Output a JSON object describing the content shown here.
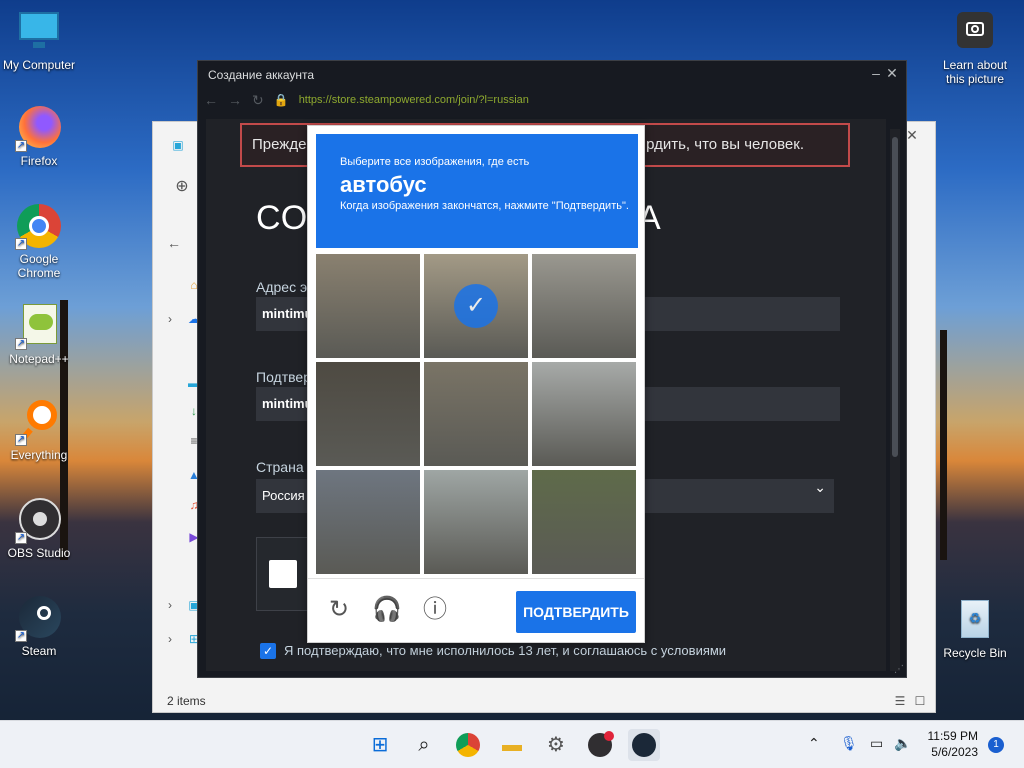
{
  "desktop": {
    "icons": [
      {
        "label": "My Computer",
        "icon": "monitor-icon"
      },
      {
        "label": "Firefox",
        "icon": "firefox-icon"
      },
      {
        "label": "Google Chrome",
        "icon": "chrome-icon"
      },
      {
        "label": "Notepad++",
        "icon": "notepadpp-icon"
      },
      {
        "label": "Everything",
        "icon": "search-magnifier-icon"
      },
      {
        "label": "OBS Studio",
        "icon": "obs-icon"
      },
      {
        "label": "Steam",
        "icon": "steam-icon"
      },
      {
        "label": "Learn about this picture",
        "icon": "camera-icon"
      },
      {
        "label": "Recycle Bin",
        "icon": "recycle-bin-icon"
      }
    ]
  },
  "explorer": {
    "status": "2 items"
  },
  "steam_window": {
    "title": "Создание аккаунта",
    "url": "https://store.steampowered.com/join/?l=russian",
    "error_left": "Прежде",
    "error_right": "рдить, что вы человек.",
    "page_title_left": "СО",
    "page_title_right": "А",
    "email_label": "Адрес э",
    "email_value": "mintimu",
    "confirm_label": "Подтвер",
    "confirm_value": "mintimu",
    "country_label": "Страна",
    "country_value": "Россия",
    "agree_text": "Я подтверждаю, что мне исполнилось 13 лет, и соглашаюсь с условиями"
  },
  "captcha": {
    "instruction": "Выберите все изображения, где есть",
    "target": "автобус",
    "hint": "Когда изображения закончатся, нажмите \"Подтвердить\".",
    "verify_label": "ПОДТВЕРДИТЬ",
    "tiles": [
      {
        "selected": false,
        "color": "#8a8170"
      },
      {
        "selected": true,
        "color": "#a39a86"
      },
      {
        "selected": false,
        "color": "#9a9890"
      },
      {
        "selected": false,
        "color": "#4e4a42"
      },
      {
        "selected": false,
        "color": "#7a7466"
      },
      {
        "selected": false,
        "color": "#a7aaa8"
      },
      {
        "selected": false,
        "color": "#6e7680"
      },
      {
        "selected": false,
        "color": "#9fa6a4"
      },
      {
        "selected": false,
        "color": "#5f6b4a"
      }
    ]
  },
  "taskbar": {
    "time": "11:59 PM",
    "date": "5/6/2023",
    "notifications": "1"
  }
}
